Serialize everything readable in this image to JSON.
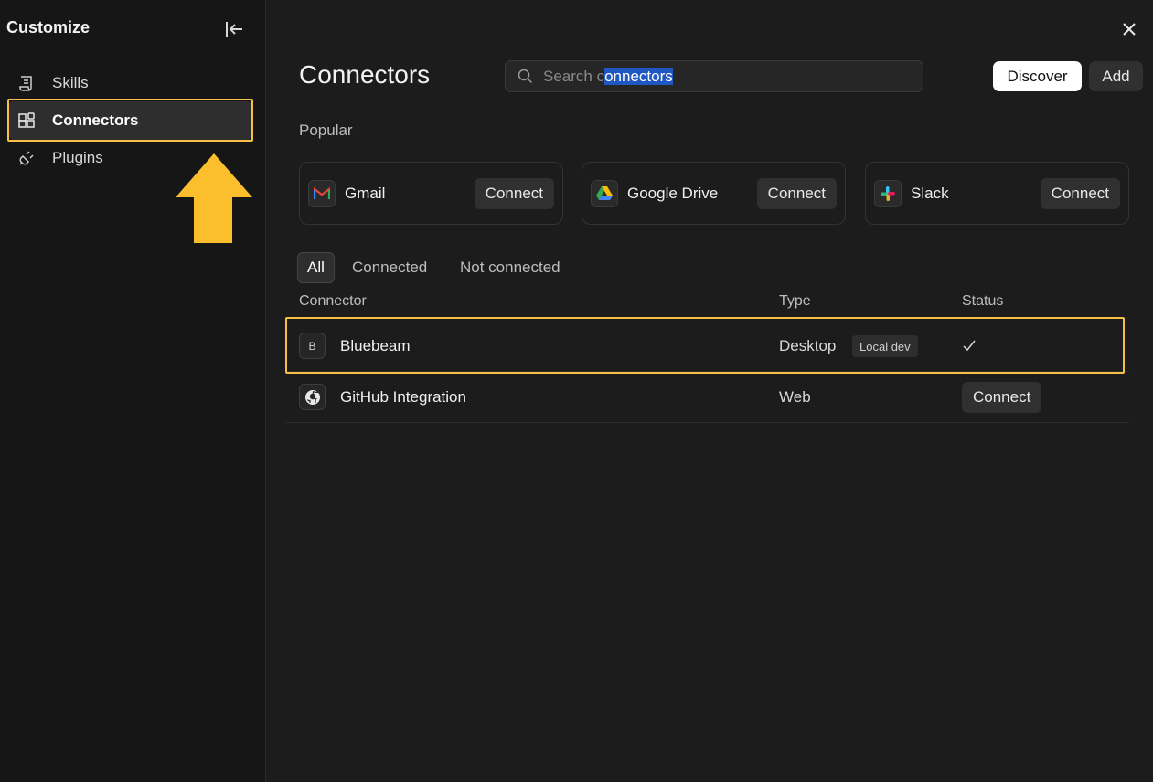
{
  "sidebar": {
    "title": "Customize",
    "items": [
      {
        "label": "Skills",
        "icon": "scroll-icon"
      },
      {
        "label": "Connectors",
        "icon": "grid-icon",
        "active": true
      },
      {
        "label": "Plugins",
        "icon": "plug-icon"
      }
    ]
  },
  "header": {
    "title": "Connectors",
    "search": {
      "prefix": "Search c",
      "selected": "onnectors"
    },
    "discover_label": "Discover",
    "add_label": "Add"
  },
  "popular": {
    "label": "Popular",
    "cards": [
      {
        "name": "Gmail",
        "icon": "gmail-icon",
        "action": "Connect"
      },
      {
        "name": "Google Drive",
        "icon": "google-drive-icon",
        "action": "Connect"
      },
      {
        "name": "Slack",
        "icon": "slack-icon",
        "action": "Connect"
      }
    ]
  },
  "filters": [
    "All",
    "Connected",
    "Not connected"
  ],
  "table": {
    "headers": [
      "Connector",
      "Type",
      "Status"
    ],
    "rows": [
      {
        "logo": "B",
        "name": "Bluebeam",
        "type": "Desktop",
        "badge": "Local dev",
        "status": "check-icon"
      },
      {
        "logo": "github-icon",
        "name": "GitHub Integration",
        "type": "Web",
        "status_action": "Connect"
      }
    ]
  },
  "colors": {
    "highlight": "#f5c046",
    "arrow": "#fbbf2e",
    "selection": "#1f57c3"
  }
}
